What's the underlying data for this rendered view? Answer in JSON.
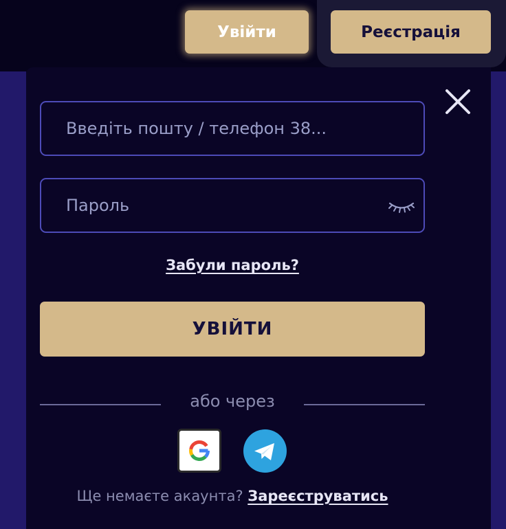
{
  "header": {
    "login_label": "Увійти",
    "register_label": "Реєстрація"
  },
  "login_form": {
    "login_field": {
      "placeholder": "Введіть пошту / телефон 38...",
      "value": ""
    },
    "password_field": {
      "placeholder": "Пароль",
      "value": ""
    },
    "forgot_password_label": "Забули пароль?",
    "submit_label": "УВІЙТИ",
    "divider_label": "або через",
    "social": {
      "google": {
        "icon": "google-icon"
      },
      "telegram": {
        "icon": "telegram-icon"
      }
    },
    "no_account_text": "Ще немаєте акаунта?",
    "signup_link_label": "Зареєструватись"
  },
  "icons": {
    "close": "close-icon",
    "toggle_password": "eye-closed-icon"
  },
  "colors": {
    "accent": "#d4b98a",
    "background": "#0a0526",
    "header_background": "#06031c",
    "side_panel": "#22196a",
    "input_border": "#4d4bb8",
    "telegram": "#2ea3df"
  }
}
